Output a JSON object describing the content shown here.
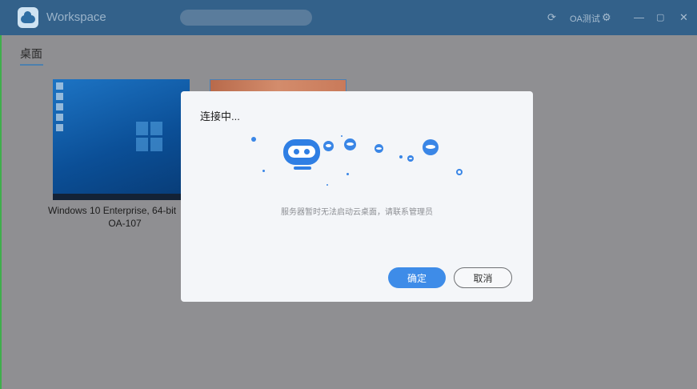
{
  "window": {
    "title": "Workspace",
    "user_label": "OA测试",
    "icons": [
      "refresh-icon",
      "gear-icon",
      "minimize-icon",
      "maximize-icon",
      "close-icon"
    ]
  },
  "tabs": [
    {
      "label": "桌面",
      "active": true
    }
  ],
  "desktops": [
    {
      "name": "Windows 10 Enterprise, 64-bit",
      "subtitle": "OA-107"
    }
  ],
  "dialog": {
    "title": "连接中...",
    "message": "服务器暂时无法启动云桌面，请联系管理员",
    "confirm_label": "确定",
    "cancel_label": "取消"
  },
  "colors": {
    "titlebar": "#33618a",
    "accent": "#3e8ce8",
    "overlay": "#8f8f92"
  }
}
